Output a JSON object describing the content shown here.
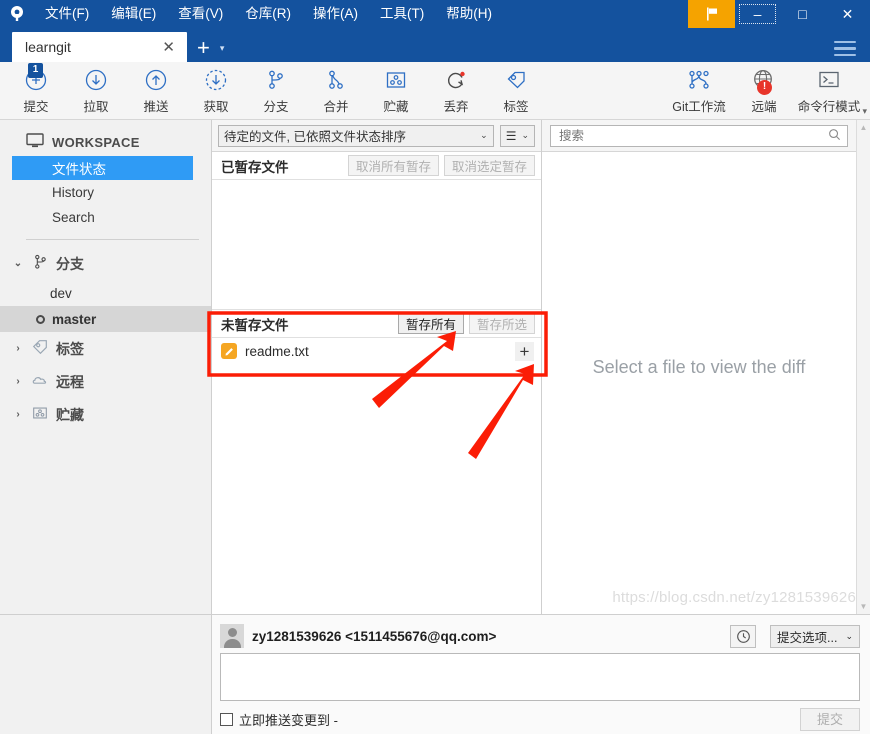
{
  "window": {
    "menu": [
      "文件(F)",
      "编辑(E)",
      "查看(V)",
      "仓库(R)",
      "操作(A)",
      "工具(T)",
      "帮助(H)"
    ],
    "minimize": "–",
    "maximize": "□",
    "close": "✕",
    "flag_icon": "flag-icon"
  },
  "tabs": {
    "items": [
      {
        "label": "learngit",
        "close": "✕"
      }
    ],
    "new_tab": "+",
    "caret": "▾"
  },
  "toolbar": {
    "items": [
      {
        "label": "提交",
        "icon": "commit-icon",
        "badge": "1"
      },
      {
        "label": "拉取",
        "icon": "pull-icon",
        "badge": ""
      },
      {
        "label": "推送",
        "icon": "push-icon",
        "badge": ""
      },
      {
        "label": "获取",
        "icon": "fetch-icon",
        "badge": ""
      },
      {
        "label": "分支",
        "icon": "branch-icon",
        "badge": ""
      },
      {
        "label": "合并",
        "icon": "merge-icon",
        "badge": ""
      },
      {
        "label": "贮藏",
        "icon": "stash-icon",
        "badge": ""
      },
      {
        "label": "丢弃",
        "icon": "discard-icon",
        "badge": ""
      },
      {
        "label": "标签",
        "icon": "tag-icon",
        "badge": ""
      }
    ],
    "right_items": [
      {
        "label": "Git工作流",
        "icon": "gitflow-icon",
        "badge": ""
      },
      {
        "label": "远端",
        "icon": "remote-globe-icon",
        "badge": "!"
      },
      {
        "label": "命令行模式",
        "icon": "terminal-icon",
        "badge": ""
      }
    ],
    "overflow": "▾"
  },
  "sidebar": {
    "workspace_label": "WORKSPACE",
    "workspace_items": [
      {
        "label": "文件状态",
        "selected": true
      },
      {
        "label": "History",
        "selected": false
      },
      {
        "label": "Search",
        "selected": false
      }
    ],
    "groups": [
      {
        "label": "分支",
        "icon": "branch-icon",
        "expanded": true,
        "twisty": "⌄",
        "children": [
          {
            "label": "dev",
            "current": false
          },
          {
            "label": "master",
            "current": true
          }
        ]
      },
      {
        "label": "标签",
        "icon": "tag-icon",
        "expanded": false,
        "twisty": "›",
        "children": []
      },
      {
        "label": "远程",
        "icon": "cloud-icon",
        "expanded": false,
        "twisty": "›",
        "children": []
      },
      {
        "label": "贮藏",
        "icon": "stash-icon",
        "expanded": false,
        "twisty": "›",
        "children": []
      }
    ]
  },
  "filterbar": {
    "sort_value": "待定的文件, 已依照文件状态排序",
    "sort_caret": "⌄",
    "view_icon": "list-view-icon",
    "view_caret": "⌄"
  },
  "search": {
    "placeholder": "搜索",
    "icon": "search-icon"
  },
  "staged": {
    "title": "已暂存文件",
    "unstage_all": "取消所有暂存",
    "unstage_selected": "取消选定暂存",
    "files": []
  },
  "unstaged": {
    "title": "未暂存文件",
    "stage_all": "暂存所有",
    "stage_selected": "暂存所选",
    "files": [
      {
        "name": "readme.txt",
        "status_icon": "modified-file-icon",
        "add_button": "+"
      }
    ]
  },
  "diff": {
    "empty_message": "Select a file to view the diff"
  },
  "commit": {
    "author": "zy1281539626 <1511455676@qq.com>",
    "history_icon": "clock-icon",
    "options_label": "提交选项...",
    "options_caret": "⌄",
    "message_value": "",
    "message_placeholder": "",
    "push_checkbox_label": "立即推送变更到 -",
    "push_checked": false,
    "commit_button": "提交"
  },
  "watermark": "https://blog.csdn.net/zy1281539626",
  "colors": {
    "titlebar": "#14529e",
    "accent_blue": "#2f9bf5",
    "flag_orange": "#f5a300",
    "file_modified": "#f5a623",
    "annotation_red": "#fb1d06"
  }
}
